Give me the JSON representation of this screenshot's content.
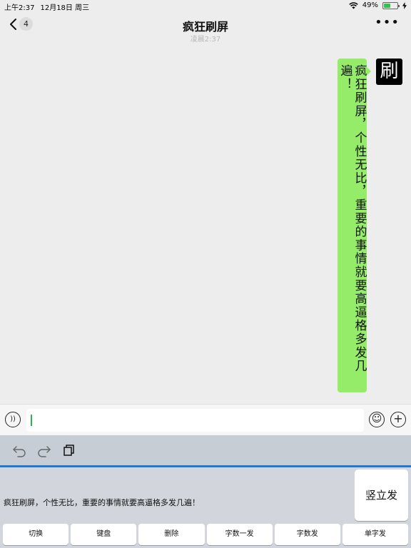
{
  "status_bar": {
    "time": "上午2:37",
    "date": "12月18日 周三",
    "battery_percent": "49%",
    "battery_level": 0.49
  },
  "nav": {
    "back_count": "4",
    "title": "疯狂刷屏",
    "timestamp": "凌晨2:37"
  },
  "chat": {
    "avatar_char": "刷",
    "message": "疯狂刷屏，个性无比，重要的事情就要高逼格多发几遍！"
  },
  "input": {
    "value": ""
  },
  "keyboard": {
    "preview_text": "疯狂刷屏，个性无比，重要的事情就要高逼格多发几遍！",
    "vertical_send_label": "竖立发",
    "keys": [
      "切换",
      "键盘",
      "删除",
      "字数一发",
      "字数发",
      "单字发"
    ]
  },
  "colors": {
    "bubble": "#95ec69",
    "accent": "#1b78d8",
    "caret": "#2ab64b"
  }
}
